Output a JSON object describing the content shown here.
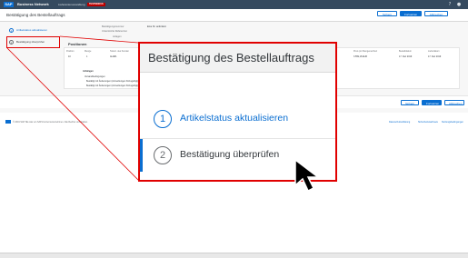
{
  "topbar": {
    "brand": "Business Network",
    "link": "Lieferantenverwaltung",
    "badge": "TESTMODUS"
  },
  "header": {
    "title": "Bestätigung des Bestellauftrags",
    "buttons": {
      "save": "Sichern",
      "next": "Fortsetzen",
      "cancel": "Abbrechen"
    }
  },
  "steps": [
    {
      "number": "1",
      "label": "Artikelstatus aktualisieren"
    },
    {
      "number": "2",
      "label": "Bestätigung überprüfen"
    }
  ],
  "form": {
    "fields": [
      {
        "label": "Bestätigungsnummer",
        "value": "Eine Nr. anfordern"
      },
      {
        "label": "Unterstützte Referenzen",
        "value": ""
      },
      {
        "label": "Anlagen",
        "value": ""
      }
    ]
  },
  "positions": {
    "title": "Positionen",
    "headers": [
      "Position",
      "Menge",
      "Teilenr. des Kunden",
      "Preis pro Mengeneinheit",
      "Bestelldatum",
      "Lieferdatum"
    ],
    "row": [
      "10",
      "1",
      "ALAB1",
      "3.559,18 EUR",
      "17. Dez 2019",
      "17. Dez 2019"
    ],
    "sub_heading": "Anhängen",
    "sub_items": [
      "Versandbedingungen",
      "Bestätigt mit Änderungen (Anmerkungen hinzugefügt)",
      "Bestätigt mit Änderungen (Anmerkungen hinzugefügt)"
    ]
  },
  "footer": {
    "copyright": "© 2019 SAP SE oder ein SAP-Konzernunternehmen. Alle Rechte vorbehalten.",
    "links": [
      "Datenschutzerklärung",
      "Sicherheitsnachweis",
      "Nutzungsbedingungen"
    ]
  },
  "zoom": {
    "title": "Bestätigung des Bestellauftrags"
  }
}
